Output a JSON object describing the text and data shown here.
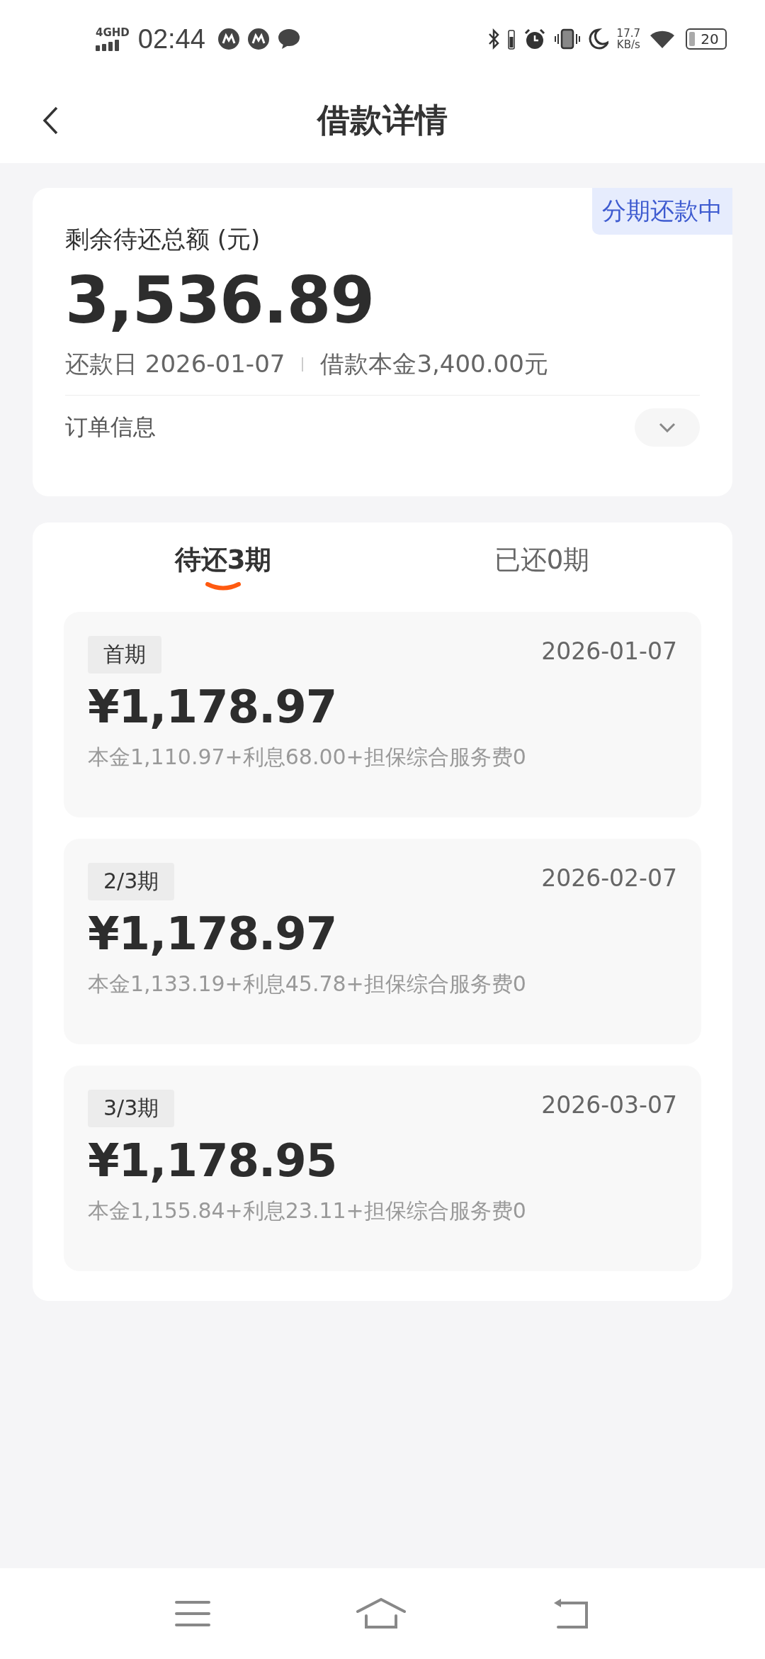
{
  "status_bar": {
    "network": "4GHD",
    "time": "02:44",
    "speed": "17.7",
    "speed_unit": "KB/s",
    "battery": "20"
  },
  "header": {
    "title": "借款详情"
  },
  "summary": {
    "status_badge": "分期还款中",
    "label": "剩余待还总额 (元)",
    "amount": "3,536.89",
    "due_date": "还款日 2026-01-07",
    "principal": "借款本金3,400.00元",
    "order_info": "订单信息",
    "expanded": false
  },
  "tabs": [
    {
      "label": "待还3期",
      "selected": true
    },
    {
      "label": "已还0期",
      "selected": false
    }
  ],
  "installments": [
    {
      "period": "首期",
      "date": "2026-01-07",
      "amount": "¥1,178.97",
      "detail": "本金1,110.97+利息68.00+担保综合服务费0"
    },
    {
      "period": "2/3期",
      "date": "2026-02-07",
      "amount": "¥1,178.97",
      "detail": "本金1,133.19+利息45.78+担保综合服务费0"
    },
    {
      "period": "3/3期",
      "date": "2026-03-07",
      "amount": "¥1,178.95",
      "detail": "本金1,155.84+利息23.11+担保综合服务费0"
    }
  ]
}
